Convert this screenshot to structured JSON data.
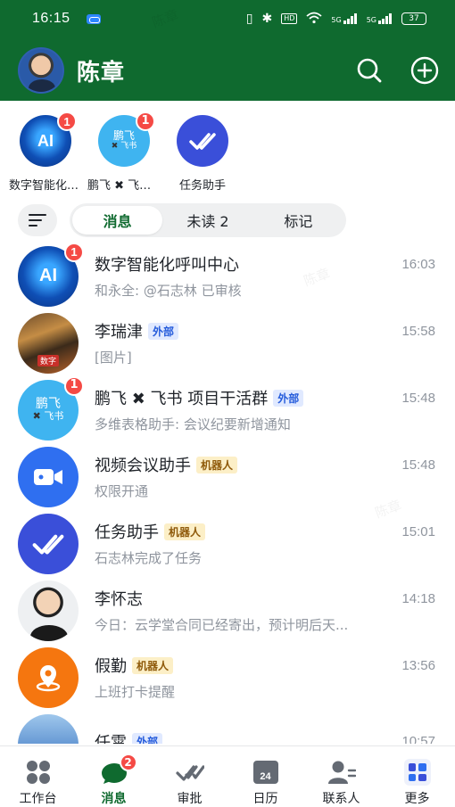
{
  "status_bar": {
    "time": "16:15",
    "network_1": "5G",
    "network_2": "5G",
    "hd": "HD",
    "battery": "37"
  },
  "header": {
    "title": "陈章",
    "search_icon": "search-icon",
    "add_icon": "plus-circle-icon"
  },
  "pinned": [
    {
      "label": "数字智能化呼叫中心",
      "avatar": "ai",
      "badge": "1"
    },
    {
      "label": "鹏飞 ✖ 飞书 项目干活群",
      "avatar": "feishu",
      "badge": "1"
    },
    {
      "label": "任务助手",
      "avatar": "task",
      "badge": ""
    }
  ],
  "filters": {
    "tabs": [
      "消息",
      "未读 2",
      "标记"
    ],
    "active": "消息"
  },
  "chats": [
    {
      "name": "数字智能化呼叫中心",
      "tag": "",
      "time": "16:03",
      "preview": "和永全: @石志林 已审核",
      "badge": "1",
      "avatar": "ai"
    },
    {
      "name": "李瑞津",
      "tag": "外部",
      "tag_type": "external",
      "time": "15:58",
      "preview": "[图片]",
      "badge": "",
      "avatar": "photo1"
    },
    {
      "name": "鹏飞 ✖ 飞书 项目干活群",
      "tag": "外部",
      "tag_type": "external",
      "time": "15:48",
      "preview": "多维表格助手: 会议纪要新增通知",
      "badge": "1",
      "avatar": "feishu"
    },
    {
      "name": "视频会议助手",
      "tag": "机器人",
      "tag_type": "robot",
      "time": "15:48",
      "preview": "权限开通",
      "badge": "",
      "avatar": "video"
    },
    {
      "name": "任务助手",
      "tag": "机器人",
      "tag_type": "robot",
      "time": "15:01",
      "preview": "石志林完成了任务",
      "badge": "",
      "avatar": "task"
    },
    {
      "name": "李怀志",
      "tag": "",
      "time": "14:18",
      "preview": "今日：云学堂合同已经寄出，预计明后天...",
      "badge": "",
      "avatar": "person2"
    },
    {
      "name": "假勤",
      "tag": "机器人",
      "tag_type": "robot",
      "time": "13:56",
      "preview": "上班打卡提醒",
      "badge": "",
      "avatar": "leave"
    },
    {
      "name": "任霄",
      "tag": "外部",
      "tag_type": "external",
      "time": "10:57",
      "preview": "",
      "badge": "",
      "avatar": "sky"
    }
  ],
  "bottom_nav": [
    {
      "label": "工作台",
      "icon": "workspace-icon",
      "badge": ""
    },
    {
      "label": "消息",
      "icon": "message-icon",
      "badge": "2"
    },
    {
      "label": "审批",
      "icon": "approval-icon",
      "badge": ""
    },
    {
      "label": "日历",
      "icon": "calendar-icon",
      "badge": "",
      "date": "24"
    },
    {
      "label": "联系人",
      "icon": "contacts-icon",
      "badge": ""
    },
    {
      "label": "更多",
      "icon": "more-apps-icon",
      "badge": ""
    }
  ],
  "watermark": "陈章",
  "colors": {
    "brand_green": "#0f6a2f",
    "badge_red": "#f54a45",
    "external_tag": "#245bdb",
    "robot_tag": "#8f5a0a"
  }
}
